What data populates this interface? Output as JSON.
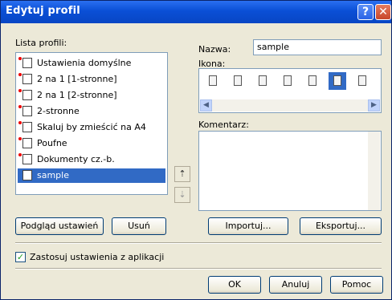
{
  "window": {
    "title": "Edytuj profil",
    "help_label": "?",
    "close_label": "✕"
  },
  "profiles": {
    "label": "Lista profili:",
    "items": [
      {
        "label": "Ustawienia domyślne",
        "icon": "default-settings-icon"
      },
      {
        "label": "2 na 1 [1-stronne]",
        "icon": "two-up-one-sided-icon"
      },
      {
        "label": "2 na 1 [2-stronne]",
        "icon": "two-up-two-sided-icon"
      },
      {
        "label": "2-stronne",
        "icon": "duplex-icon"
      },
      {
        "label": "Skaluj by zmieścić na A4",
        "icon": "scale-to-a4-icon"
      },
      {
        "label": "Poufne",
        "icon": "confidential-icon"
      },
      {
        "label": "Dokumenty cz.-b.",
        "icon": "bw-document-icon"
      },
      {
        "label": "sample",
        "icon": "sample-profile-icon",
        "selected": true
      }
    ]
  },
  "name": {
    "label": "Nazwa:",
    "value": "sample"
  },
  "icon_picker": {
    "label": "Ikona:",
    "selected_index": 5
  },
  "comment": {
    "label": "Komentarz:",
    "value": ""
  },
  "buttons": {
    "preview": "Podgląd ustawień",
    "delete": "Usuń",
    "import": "Importuj...",
    "export": "Eksportuj...",
    "ok": "OK",
    "cancel": "Anuluj",
    "help": "Pomoc"
  },
  "apply_from_app": {
    "label": "Zastosuj ustawienia z aplikacji",
    "checked": true
  },
  "colors": {
    "titlebar": "#0a4fd6",
    "selection": "#316ac5",
    "dialog_bg": "#ece9d8"
  }
}
